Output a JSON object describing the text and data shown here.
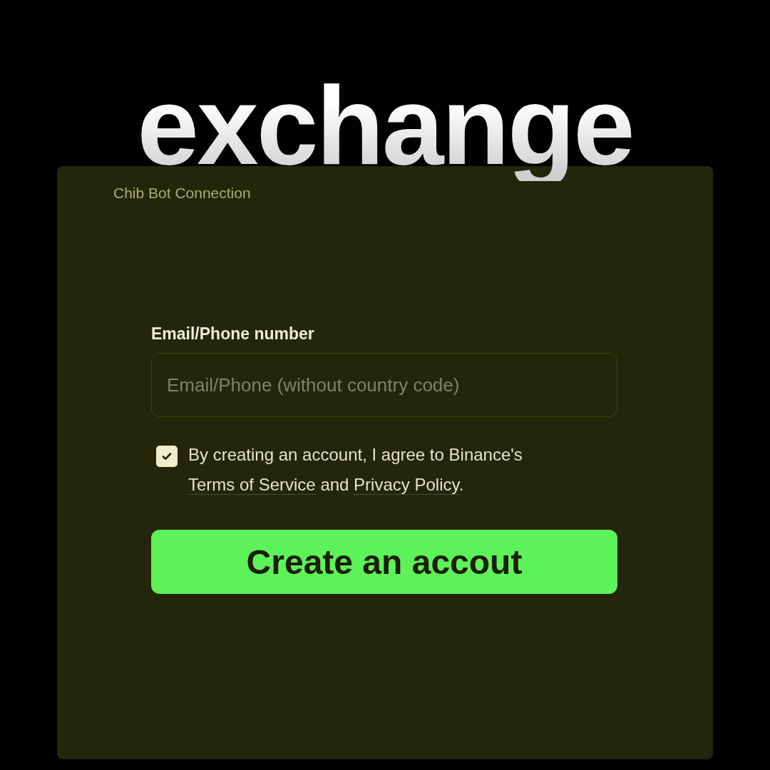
{
  "headline": "exchange",
  "card": {
    "title": "Chib Bot Connection",
    "field": {
      "label": "Email/Phone number",
      "placeholder": "Email/Phone (without country code)"
    },
    "agreement": {
      "checked": true,
      "parts": [
        {
          "kind": "text",
          "text": "By creating an account, I agree to Binance's"
        },
        {
          "kind": "link",
          "text": "Terms of Service"
        },
        {
          "kind": "text",
          "text": "and"
        },
        {
          "kind": "link",
          "text": "Privacy Policy"
        },
        {
          "kind": "text",
          "text": "."
        }
      ]
    },
    "button": "Create an accout"
  }
}
